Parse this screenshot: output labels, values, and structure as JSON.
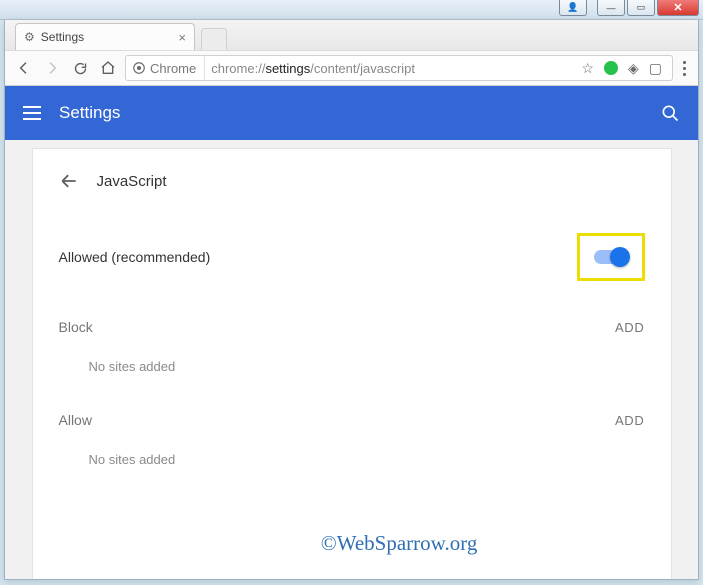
{
  "window_controls": {
    "user": "👤",
    "minimize": "—",
    "maximize": "▭",
    "close": "✕"
  },
  "tab": {
    "title": "Settings",
    "favicon": "⚙"
  },
  "toolbar": {
    "secure_label": "Chrome"
  },
  "url": {
    "scheme": "chrome://",
    "host": "settings",
    "path": "/content/javascript"
  },
  "settings_header": {
    "title": "Settings"
  },
  "page": {
    "title": "JavaScript",
    "allowed_label": "Allowed (recommended)",
    "toggle_on": true,
    "sections": [
      {
        "label": "Block",
        "action": "ADD",
        "empty": "No sites added"
      },
      {
        "label": "Allow",
        "action": "ADD",
        "empty": "No sites added"
      }
    ]
  },
  "watermark": "©WebSparrow.org"
}
